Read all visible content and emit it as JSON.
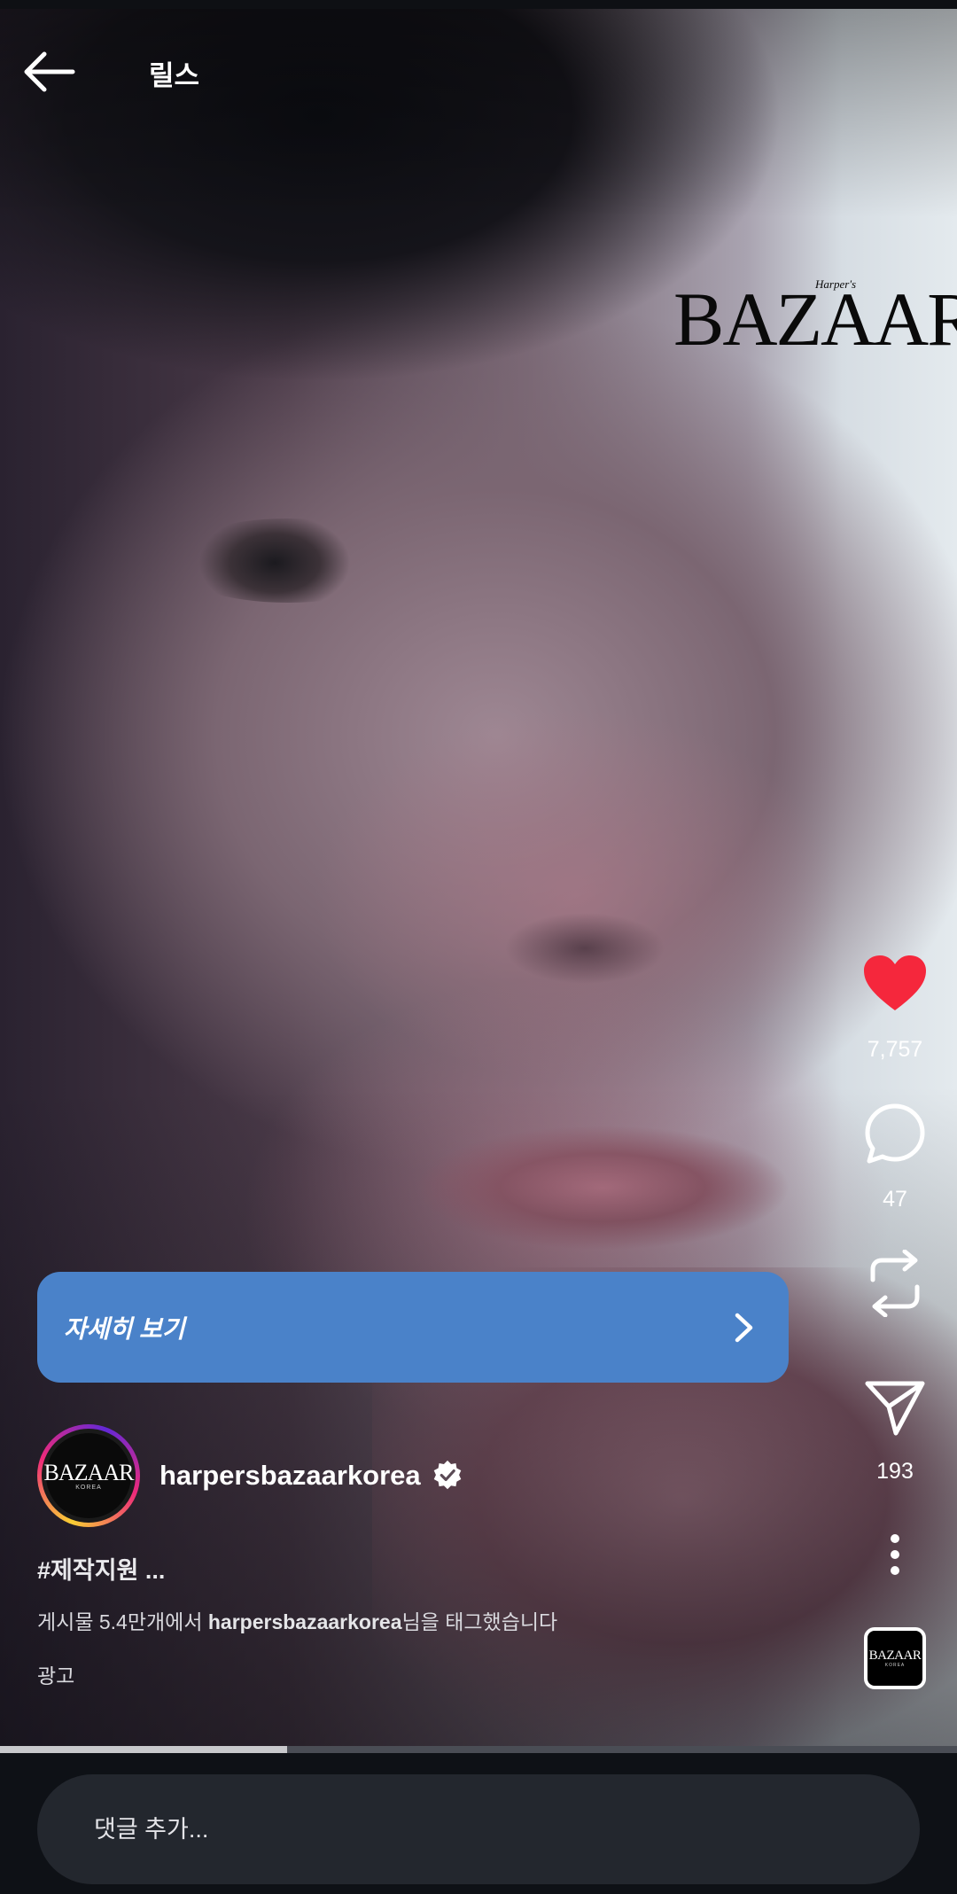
{
  "header": {
    "title": "릴스"
  },
  "brand_logo": {
    "text": "BAZAAR",
    "small": "Harper's"
  },
  "rail": {
    "like_count": "7,757",
    "comment_count": "47",
    "share_count": "193",
    "thumb_text": "BAZAAR",
    "thumb_sub": "KOREA"
  },
  "cta": {
    "label": "자세히 보기"
  },
  "account": {
    "username": "harpersbazaarkorea",
    "avatar_text": "BAZAAR",
    "avatar_sub": "KOREA"
  },
  "caption": {
    "hashtag": "#제작지원 ...",
    "tagged_prefix": "게시물 5.4만개에서 ",
    "tagged_user": "harpersbazaarkorea",
    "tagged_suffix": "님을 태그했습니다",
    "ad_label": "광고"
  },
  "progress": {
    "fraction": 0.3
  },
  "comment": {
    "placeholder": "댓글 추가..."
  },
  "colors": {
    "like": "#f5273c",
    "cta": "#4a82c9",
    "verified": "#ffffff"
  }
}
